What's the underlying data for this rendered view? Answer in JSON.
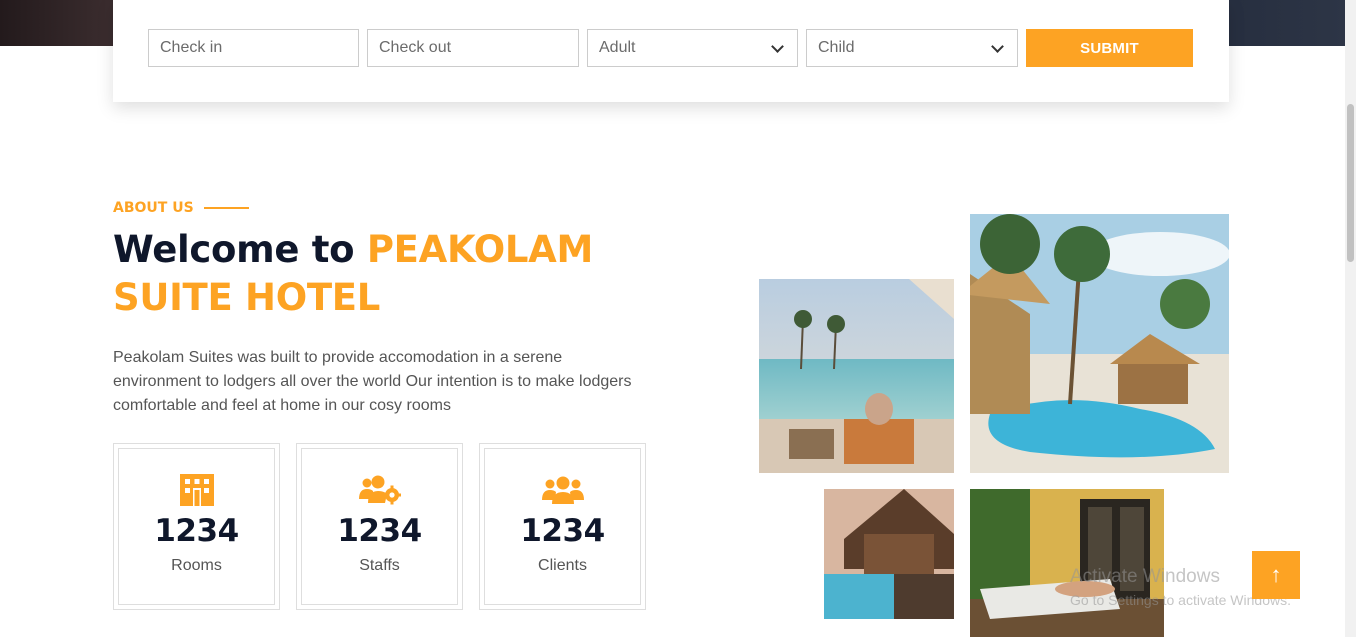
{
  "booking": {
    "check_in_placeholder": "Check in",
    "check_out_placeholder": "Check out",
    "adult_value": "Adult",
    "child_value": "Child",
    "submit_label": "SUBMIT"
  },
  "about": {
    "eyebrow": "ABOUT US",
    "title_prefix": "Welcome to",
    "title_accent_line1": "PEAKOLAM",
    "title_accent_line2": "SUITE HOTEL",
    "description": "Peakolam Suites was built to provide accomodation in a serene environment to lodgers all over the world Our intention is to make lodgers comfortable and feel at home in our cosy rooms"
  },
  "stats": [
    {
      "icon": "hotel-icon",
      "value": "1234",
      "label": "Rooms"
    },
    {
      "icon": "users-cog-icon",
      "value": "1234",
      "label": "Staffs"
    },
    {
      "icon": "users-icon",
      "value": "1234",
      "label": "Clients"
    }
  ],
  "watermark": {
    "line1": "Activate Windows",
    "line2": "Go to Settings to activate Windows."
  },
  "back_to_top": {
    "icon": "arrow-up-icon",
    "glyph": "↑"
  },
  "colors": {
    "accent": "#fda323",
    "dark": "#0f172b",
    "text": "#555555"
  }
}
